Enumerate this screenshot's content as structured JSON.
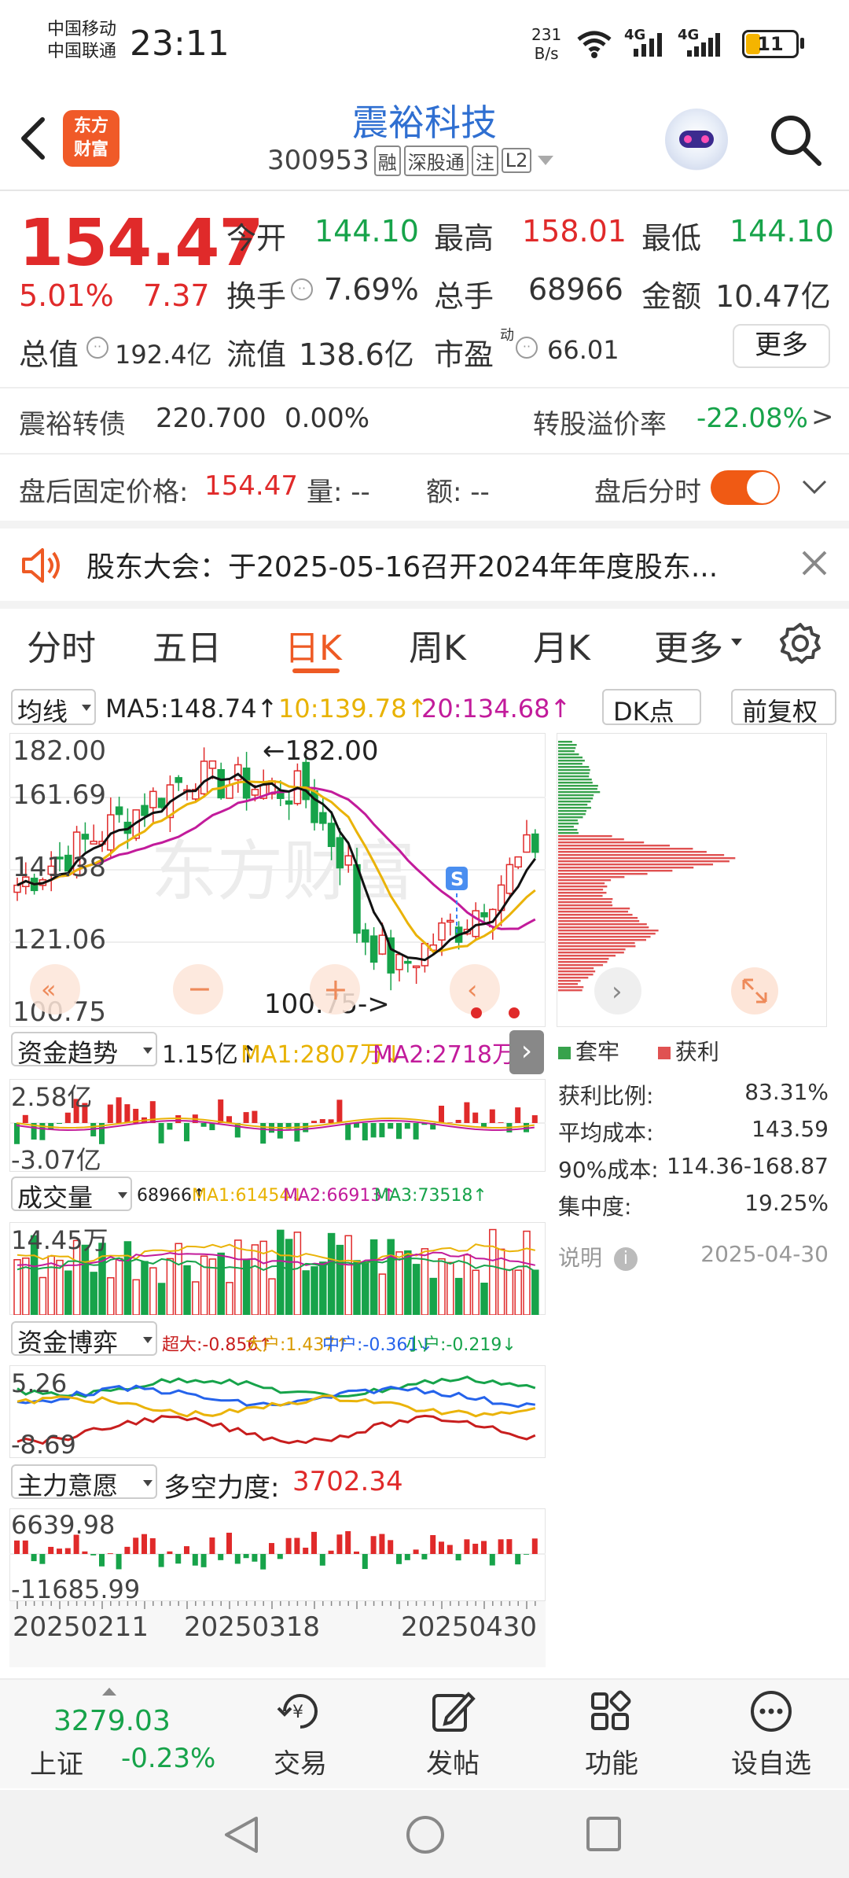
{
  "status_bar": {
    "carrier1": "中国移动",
    "carrier2": "中国联通",
    "time": "23:11",
    "net_speed_top": "231",
    "net_speed_bottom": "B/s",
    "net1": "4G",
    "net2": "4G",
    "battery": "11"
  },
  "header": {
    "back_icon": "back-arrow-icon",
    "logo_line1": "东方",
    "logo_line2": "财富",
    "title": "震裕科技",
    "code": "300953",
    "badges": [
      "融",
      "深股通",
      "注",
      "L2"
    ],
    "search_icon": "search-icon"
  },
  "quote": {
    "price": "154.47",
    "change_pct": "5.01%",
    "change": "7.37",
    "open_label": "今开",
    "open": "144.10",
    "high_label": "最高",
    "high": "158.01",
    "low_label": "最低",
    "low": "144.10",
    "turnover_label": "换手",
    "turnover": "7.69%",
    "volume_label": "总手",
    "volume": "68966",
    "amount_label": "金额",
    "amount": "10.47亿",
    "mcap_label": "总值",
    "mcap": "192.4亿",
    "float_label": "流值",
    "float": "138.6亿",
    "pe_label": "市盈",
    "pe_sup": "动",
    "pe": "66.01",
    "more_label": "更多"
  },
  "convertible": {
    "name": "震裕转债",
    "price": "220.700",
    "change": "0.00%",
    "premium_label": "转股溢价率",
    "premium": "-22.08%"
  },
  "after_hours": {
    "label": "盘后固定价格:",
    "price": "154.47",
    "vol_label": "量: --",
    "amt_label": "额: --",
    "toggle_label": "盘后分时"
  },
  "notice": {
    "text": "股东大会：于2025-05-16召开2024年年度股东..."
  },
  "tabs": [
    "分时",
    "五日",
    "日K",
    "周K",
    "月K",
    "更多"
  ],
  "ma_row": {
    "selector": "均线",
    "ma5": "MA5:148.74↑",
    "ma10": "10:139.78↑",
    "ma20": "20:134.68↑",
    "dk_label": "DK点",
    "adjust_label": "前复权"
  },
  "kline": {
    "y_labels": [
      "182.00",
      "161.69",
      "141.38",
      "121.06",
      "100.75"
    ],
    "high_marker": "←182.00",
    "low_marker": "100.75->",
    "watermark": "东方财富",
    "s_marker": "S"
  },
  "chip_panel": {
    "legend_trap": "套牢",
    "legend_profit": "获利",
    "stats": [
      {
        "label": "获利比例:",
        "value": "83.31%"
      },
      {
        "label": "平均成本:",
        "value": "143.59"
      },
      {
        "label": "90%成本:",
        "value": "114.36-168.87"
      },
      {
        "label": "集中度:",
        "value": "19.25%"
      }
    ],
    "note_label": "说明",
    "date": "2025-04-30"
  },
  "fund_trend": {
    "selector": "资金趋势",
    "value": "1.15亿↑",
    "ma1": "MA1:2807万↓",
    "ma2": "MA2:2718万↑",
    "y_top": "2.58亿",
    "y_bottom": "-3.07亿"
  },
  "volume": {
    "selector": "成交量",
    "value": "68966↑",
    "ma1": "MA1:61454↓",
    "ma2": "MA2:66913↑",
    "ma3": "MA3:73518↑",
    "y_top": "14.45万"
  },
  "fund_game": {
    "selector": "资金博弈",
    "super": "超大:-0.856↑",
    "large": "大户:1.437↑",
    "mid": "中户:-0.361↓",
    "small": "小户:-0.219↓",
    "y_top": "5.26",
    "y_bottom": "-8.69"
  },
  "main_will": {
    "selector": "主力意愿",
    "label": "多空力度:",
    "value": "3702.34",
    "y_top": "6639.98",
    "y_bottom": "-11685.99"
  },
  "x_axis": [
    "20250211",
    "20250318",
    "20250430"
  ],
  "bottom_bar": {
    "index_value": "3279.03",
    "index_name": "上证",
    "index_change": "-0.23%",
    "items": [
      {
        "label": "交易",
        "icon": "trade-icon"
      },
      {
        "label": "发帖",
        "icon": "edit-icon"
      },
      {
        "label": "功能",
        "icon": "grid-icon"
      },
      {
        "label": "设自选",
        "icon": "more-icon"
      }
    ]
  },
  "colors": {
    "up": "#e02a2a",
    "down": "#17a34a",
    "accent": "#ee5a24",
    "title": "#2f6fd1"
  }
}
